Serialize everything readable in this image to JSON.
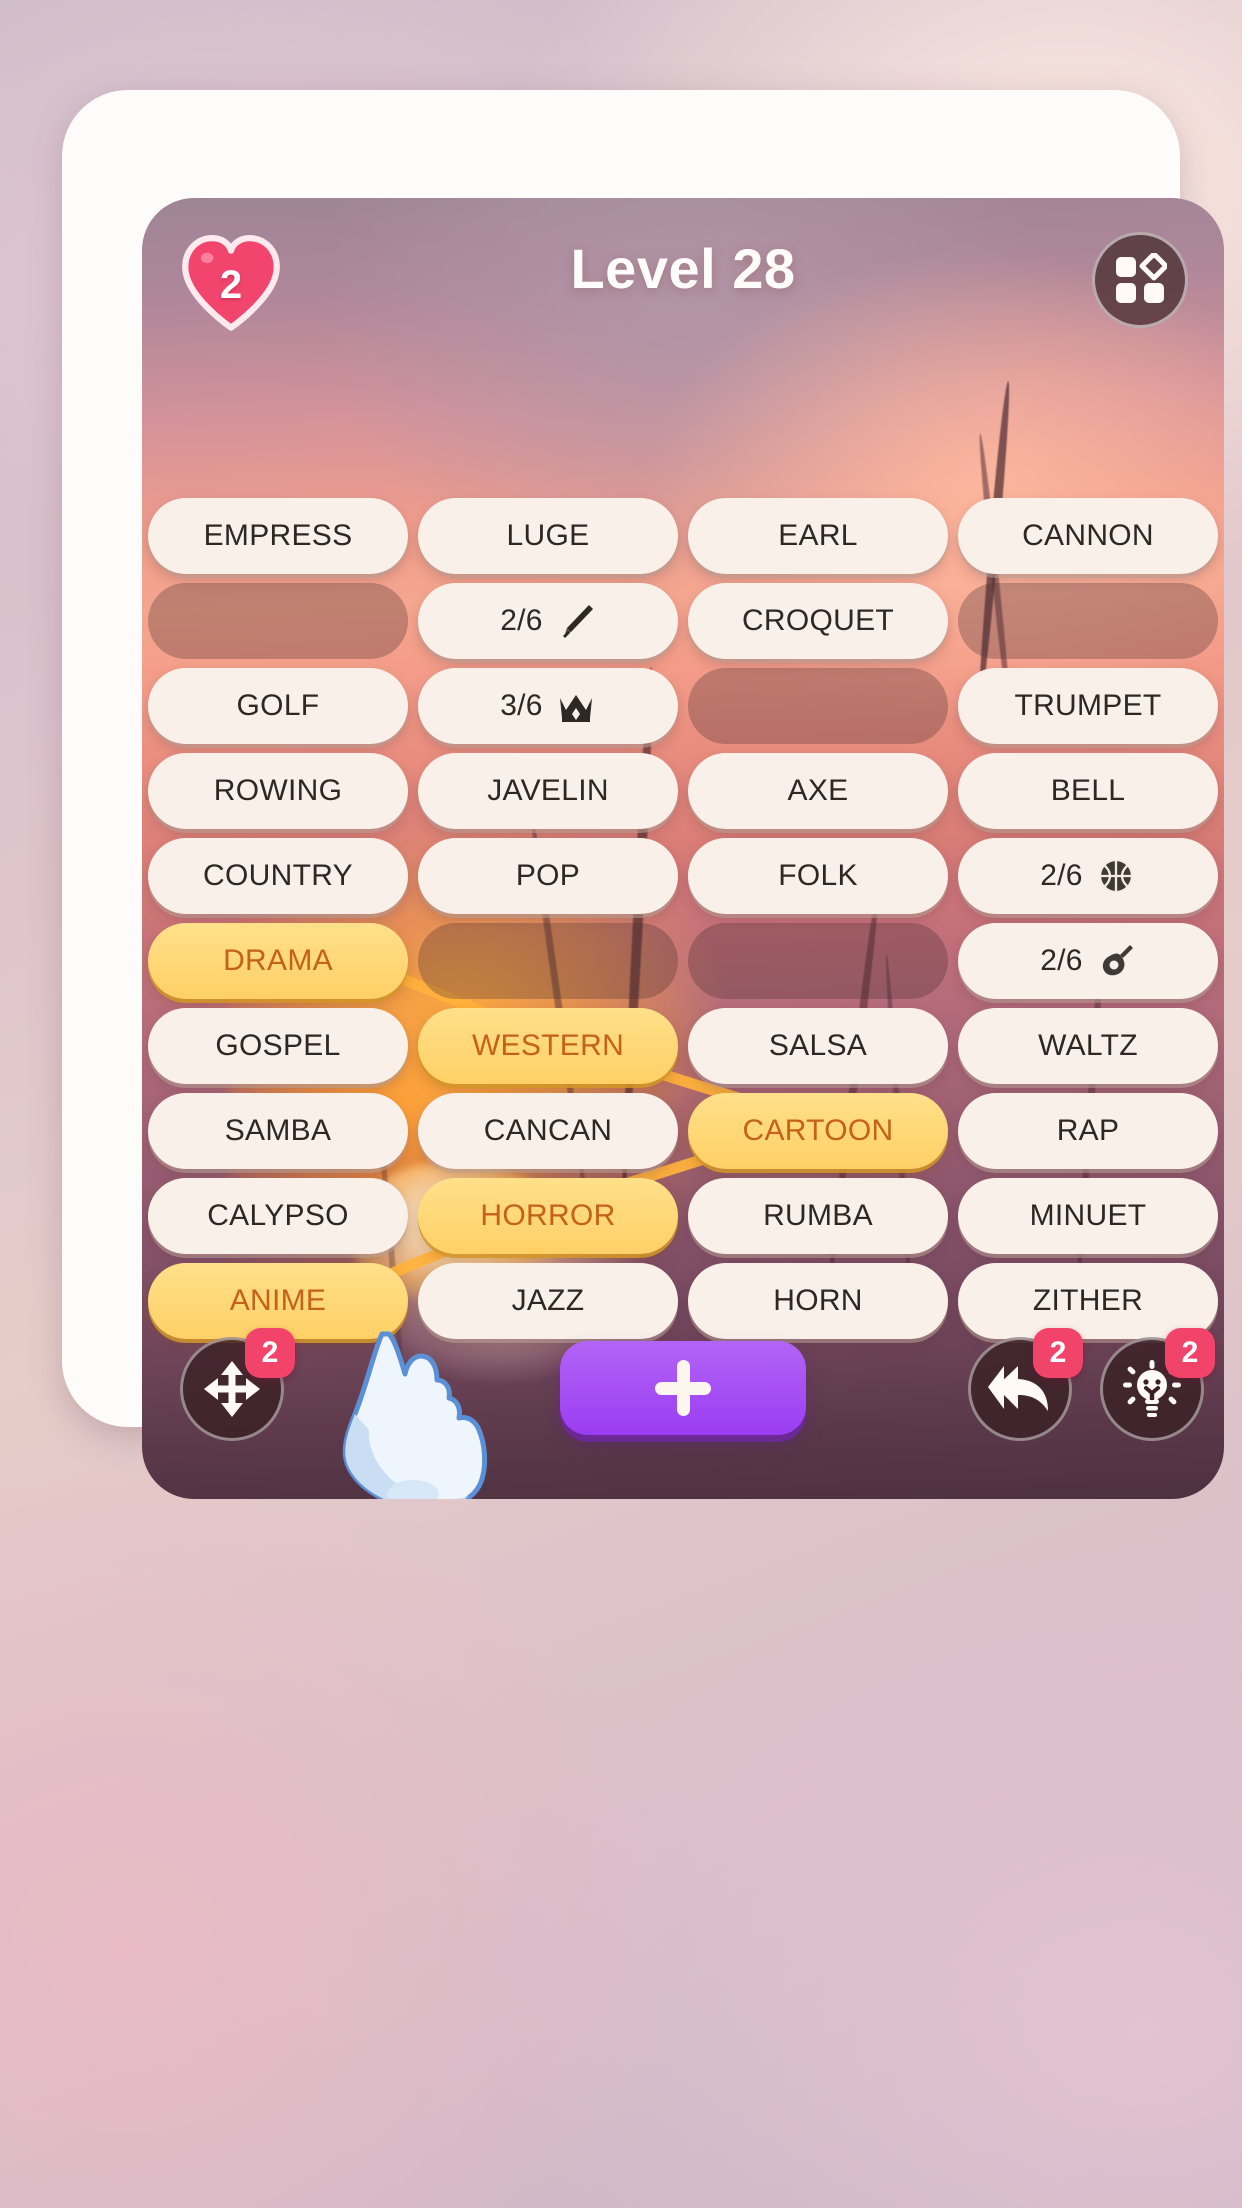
{
  "header": {
    "title": "Level 28",
    "lives": "2",
    "lives_icon": "heart-icon",
    "categories_icon": "categories-grid-icon"
  },
  "colors": {
    "selected_tile_bg": "#ffd066",
    "selected_tile_text": "#c4611b",
    "tile_bg": "#f9f0ea",
    "tile_text": "#2d2823",
    "badge": "#f2436b",
    "heart": "#f2456e",
    "add_button": "#9a3df2",
    "link_line": "#ffb23c"
  },
  "grid": {
    "columns": 4,
    "tiles": [
      {
        "type": "word",
        "label": "EMPRESS",
        "selected": false
      },
      {
        "type": "word",
        "label": "LUGE",
        "selected": false
      },
      {
        "type": "word",
        "label": "EARL",
        "selected": false
      },
      {
        "type": "word",
        "label": "CANNON",
        "selected": false
      },
      {
        "type": "empty",
        "label": "",
        "selected": false
      },
      {
        "type": "counter",
        "label": "2/6",
        "icon": "knife-icon",
        "selected": false
      },
      {
        "type": "word",
        "label": "CROQUET",
        "selected": false
      },
      {
        "type": "empty",
        "label": "",
        "selected": false
      },
      {
        "type": "word",
        "label": "GOLF",
        "selected": false
      },
      {
        "type": "counter",
        "label": "3/6",
        "icon": "crown-icon",
        "selected": false
      },
      {
        "type": "empty",
        "label": "",
        "selected": false
      },
      {
        "type": "word",
        "label": "TRUMPET",
        "selected": false
      },
      {
        "type": "word",
        "label": "ROWING",
        "selected": false
      },
      {
        "type": "word",
        "label": "JAVELIN",
        "selected": false
      },
      {
        "type": "word",
        "label": "AXE",
        "selected": false
      },
      {
        "type": "word",
        "label": "BELL",
        "selected": false
      },
      {
        "type": "word",
        "label": "COUNTRY",
        "selected": false
      },
      {
        "type": "word",
        "label": "POP",
        "selected": false
      },
      {
        "type": "word",
        "label": "FOLK",
        "selected": false
      },
      {
        "type": "counter",
        "label": "2/6",
        "icon": "basketball-icon",
        "selected": false
      },
      {
        "type": "word",
        "label": "DRAMA",
        "selected": true
      },
      {
        "type": "empty",
        "label": "",
        "selected": false
      },
      {
        "type": "empty",
        "label": "",
        "selected": false
      },
      {
        "type": "counter",
        "label": "2/6",
        "icon": "guitar-icon",
        "selected": false
      },
      {
        "type": "word",
        "label": "GOSPEL",
        "selected": false
      },
      {
        "type": "word",
        "label": "WESTERN",
        "selected": true
      },
      {
        "type": "word",
        "label": "SALSA",
        "selected": false
      },
      {
        "type": "word",
        "label": "WALTZ",
        "selected": false
      },
      {
        "type": "word",
        "label": "SAMBA",
        "selected": false
      },
      {
        "type": "word",
        "label": "CANCAN",
        "selected": false
      },
      {
        "type": "word",
        "label": "CARTOON",
        "selected": true
      },
      {
        "type": "word",
        "label": "RAP",
        "selected": false
      },
      {
        "type": "word",
        "label": "CALYPSO",
        "selected": false
      },
      {
        "type": "word",
        "label": "HORROR",
        "selected": true
      },
      {
        "type": "word",
        "label": "RUMBA",
        "selected": false
      },
      {
        "type": "word",
        "label": "MINUET",
        "selected": false
      },
      {
        "type": "word",
        "label": "ANIME",
        "selected": true
      },
      {
        "type": "word",
        "label": "JAZZ",
        "selected": false
      },
      {
        "type": "word",
        "label": "HORN",
        "selected": false
      },
      {
        "type": "word",
        "label": "ZITHER",
        "selected": false
      }
    ],
    "selected_path": [
      "DRAMA",
      "WESTERN",
      "CARTOON",
      "HORROR",
      "ANIME"
    ]
  },
  "toolbar": {
    "shuffle": {
      "icon": "shuffle-arrows-icon",
      "badge": "2"
    },
    "add": {
      "icon": "plus-icon"
    },
    "undo": {
      "icon": "undo-arrow-icon",
      "badge": "2"
    },
    "hint": {
      "icon": "lightbulb-icon",
      "badge": "2"
    }
  },
  "cursor": {
    "icon": "pointing-hand-cursor"
  }
}
